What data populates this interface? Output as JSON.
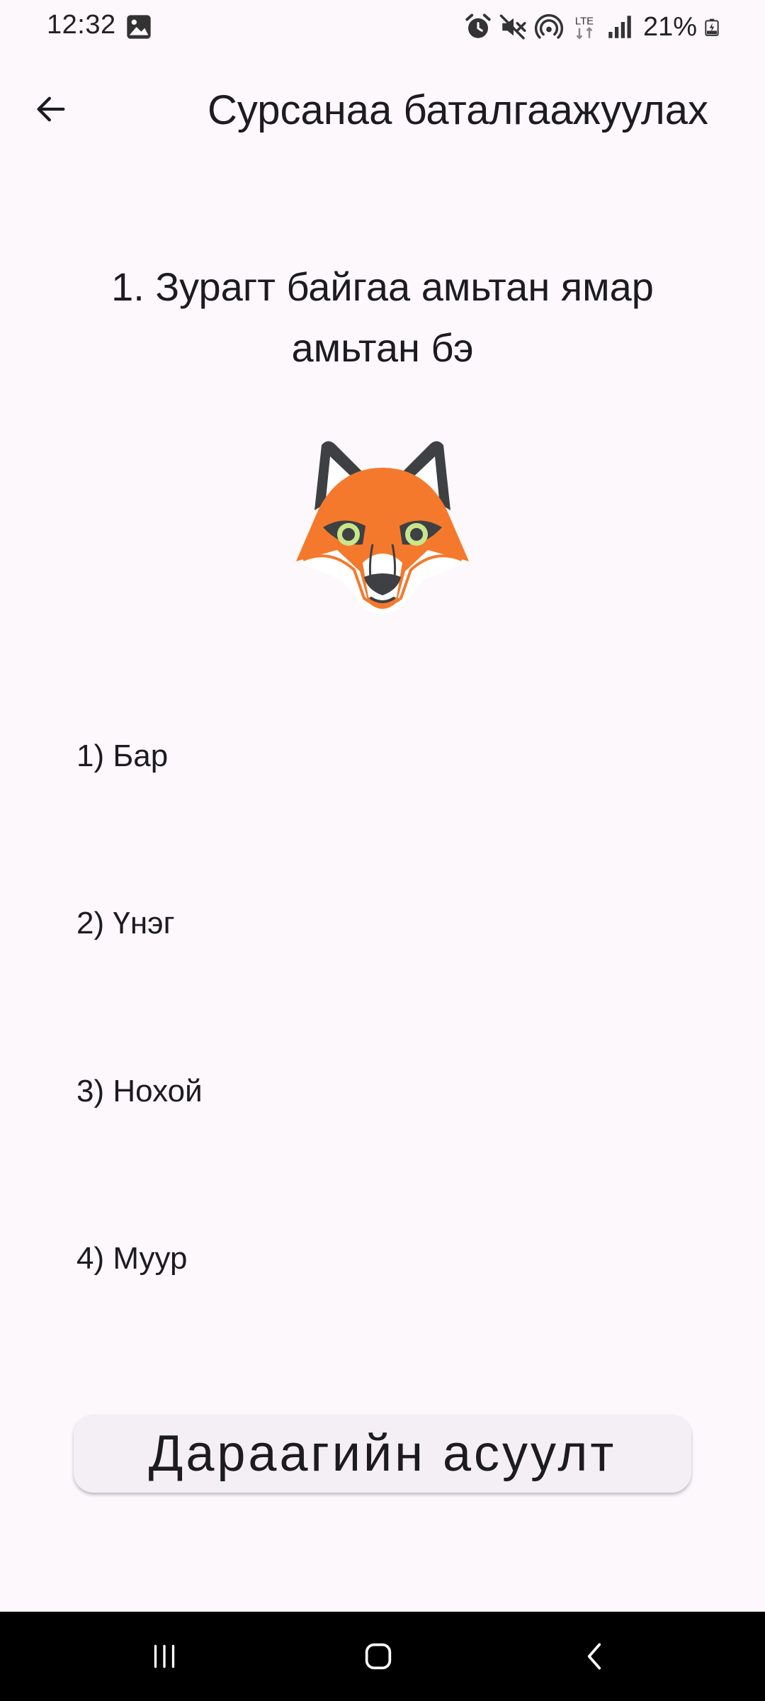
{
  "status_bar": {
    "time": "12:32",
    "left_icons": [
      "image-icon"
    ],
    "right_icons": [
      "alarm-icon",
      "mute-icon",
      "hotspot-icon",
      "lte-icon",
      "signal-icon"
    ],
    "lte_label": "LTE",
    "battery_percent": "21%"
  },
  "app_bar": {
    "title": "Сурсанаа баталгаажуулах",
    "back_icon": "arrow-back-icon"
  },
  "question": {
    "text": "1. Зурагт байгаа амьтан ямар амьтан бэ",
    "image": "fox-face-icon"
  },
  "options": [
    {
      "label": "1) Бар"
    },
    {
      "label": "2) Үнэг"
    },
    {
      "label": "3) Нохой"
    },
    {
      "label": "4) Муур"
    }
  ],
  "next_button": {
    "label": "Дараагийн асуулт"
  },
  "nav_bar": {
    "icons": [
      "recents-icon",
      "home-icon",
      "back-nav-icon"
    ]
  },
  "colors": {
    "background": "#fdf8fc",
    "fox_orange": "#f4792c",
    "fox_dark": "#3e4043",
    "fox_eye": "#c8e68a",
    "button_bg": "#f4eff5",
    "nav_bg": "#000000"
  }
}
